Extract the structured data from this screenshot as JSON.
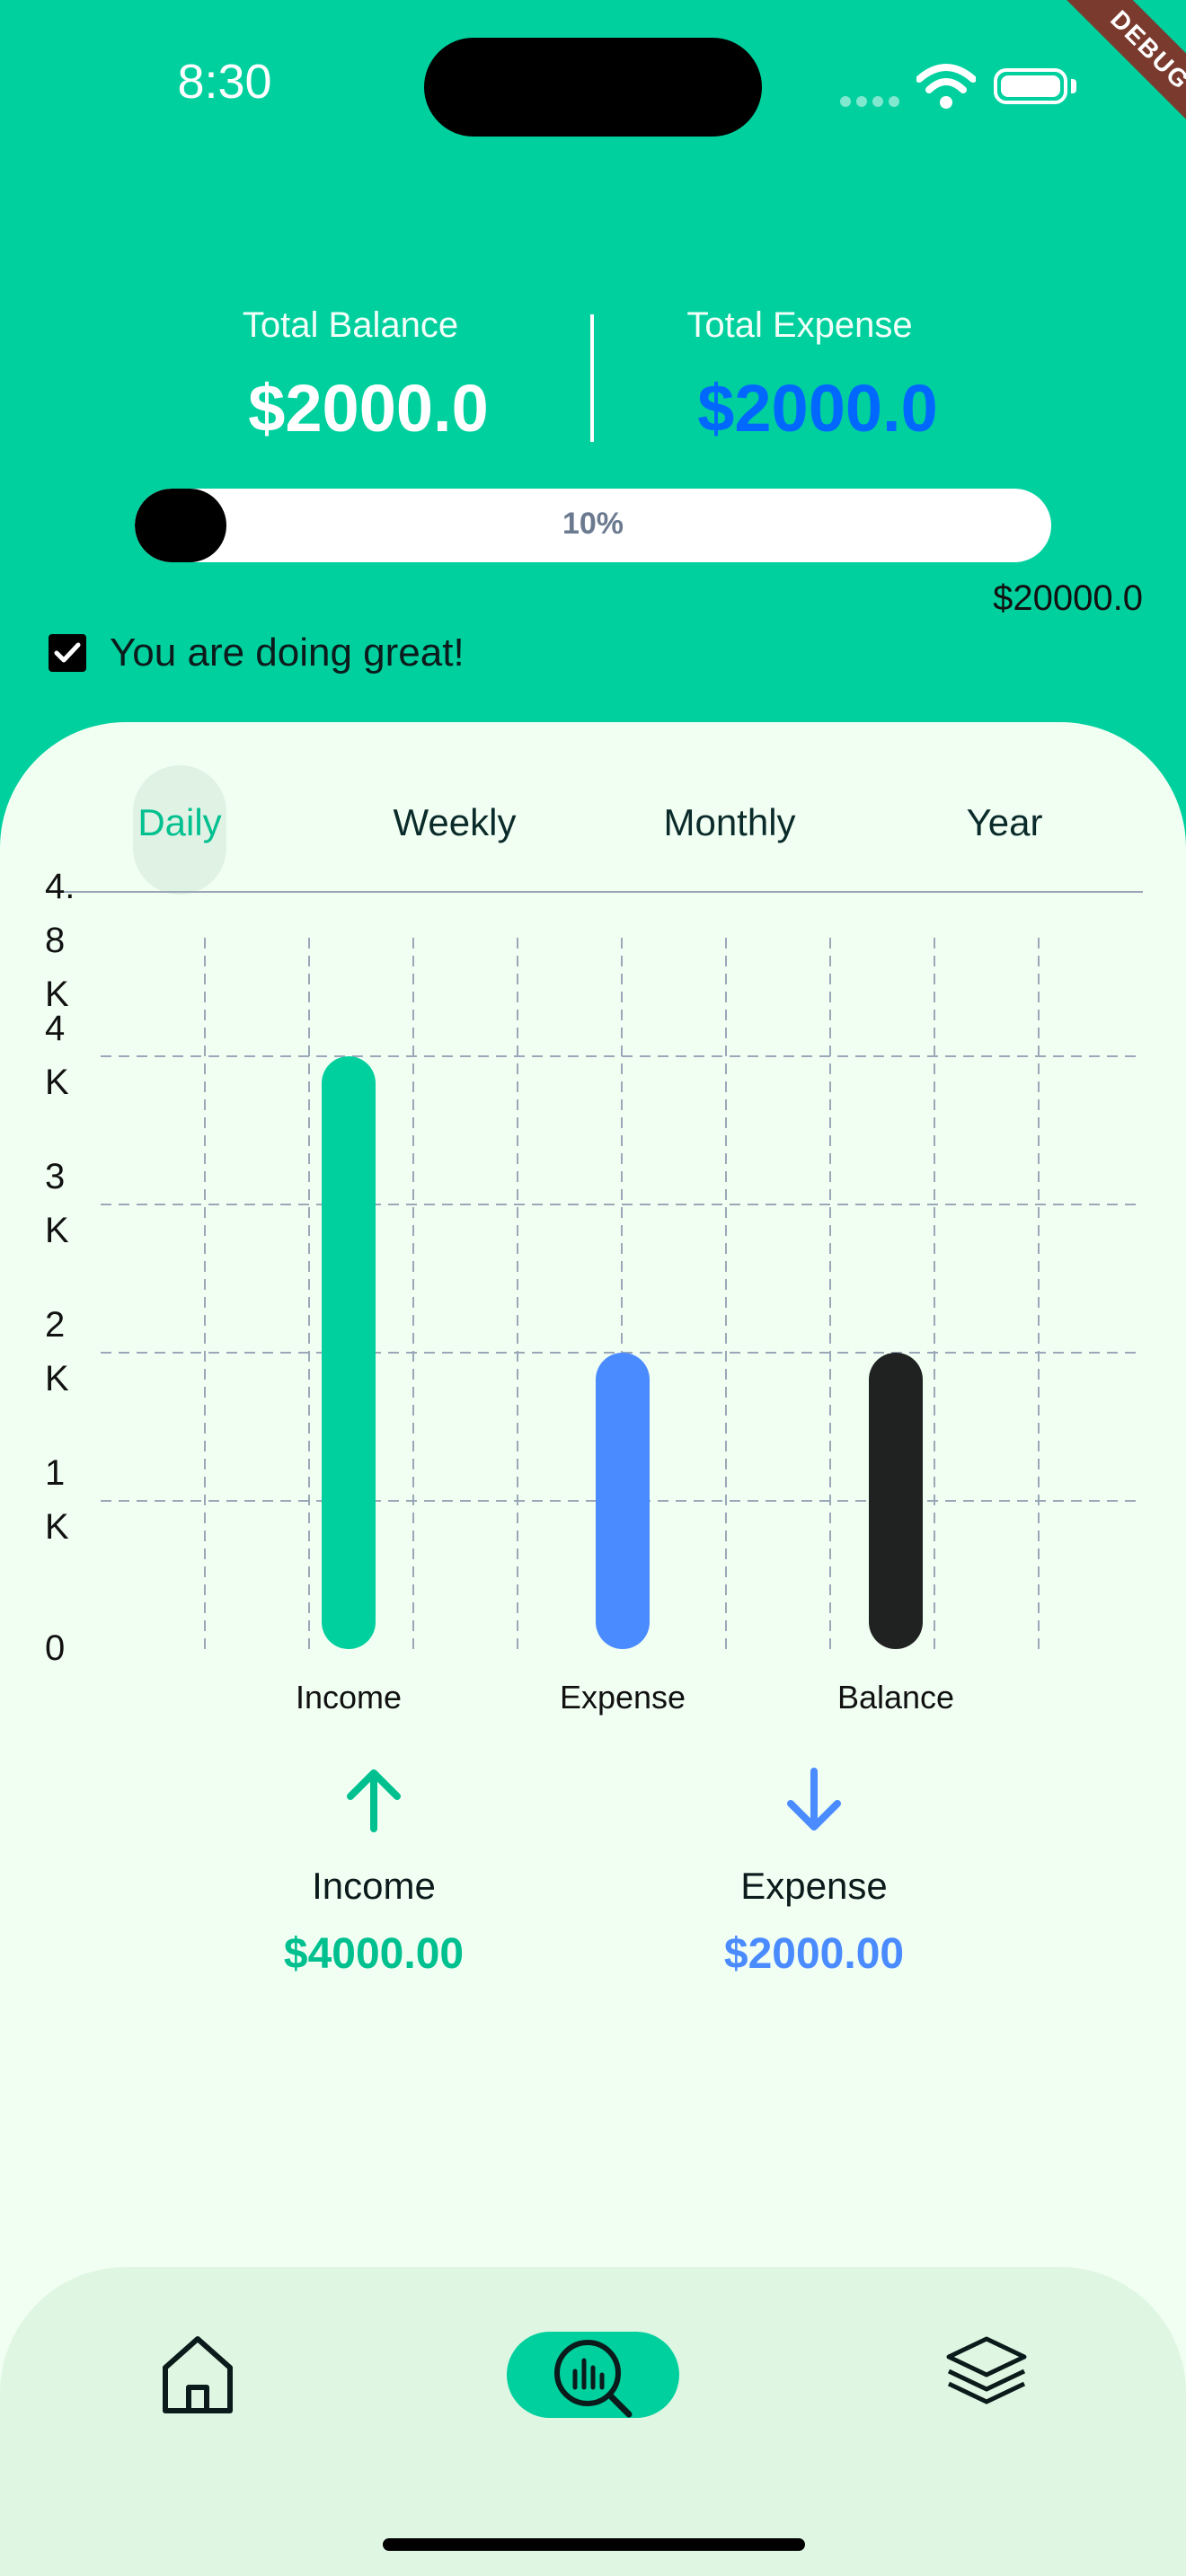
{
  "status_bar": {
    "time": "8:30",
    "debug_label": "DEBUG"
  },
  "header": {
    "total_balance_label": "Total Balance",
    "total_balance_value": "$2000.0",
    "total_expense_label": "Total Expense",
    "total_expense_value": "$2000.0",
    "progress_text": "10%",
    "progress_fraction": 0.1,
    "goal_amount": "$20000.0",
    "status_message": "You are doing great!",
    "status_checked": true
  },
  "tabs": [
    {
      "label": "Daily",
      "active": true
    },
    {
      "label": "Weekly",
      "active": false
    },
    {
      "label": "Monthly",
      "active": false
    },
    {
      "label": "Year",
      "active": false
    }
  ],
  "chart_data": {
    "type": "bar",
    "categories": [
      "Income",
      "Expense",
      "Balance"
    ],
    "values": [
      4000,
      2000,
      2000
    ],
    "colors": [
      "#00D09E",
      "#4A8BFF",
      "#202222"
    ],
    "y_tick_labels": [
      "0",
      "1 K",
      "2 K",
      "3 K",
      "4 K",
      "4.8 K"
    ],
    "y_tick_values": [
      0,
      1000,
      2000,
      3000,
      4000,
      4800
    ],
    "ylim": [
      0,
      4800
    ],
    "grid": true
  },
  "summary": {
    "income_label": "Income",
    "income_value": "$4000.00",
    "income_color": "#00C08F",
    "expense_label": "Expense",
    "expense_value": "$2000.00",
    "expense_color": "#4A8BFF"
  },
  "nav": {
    "items": [
      {
        "icon": "home-icon",
        "active": false
      },
      {
        "icon": "analysis-icon",
        "active": true
      },
      {
        "icon": "layers-icon",
        "active": false
      }
    ]
  }
}
